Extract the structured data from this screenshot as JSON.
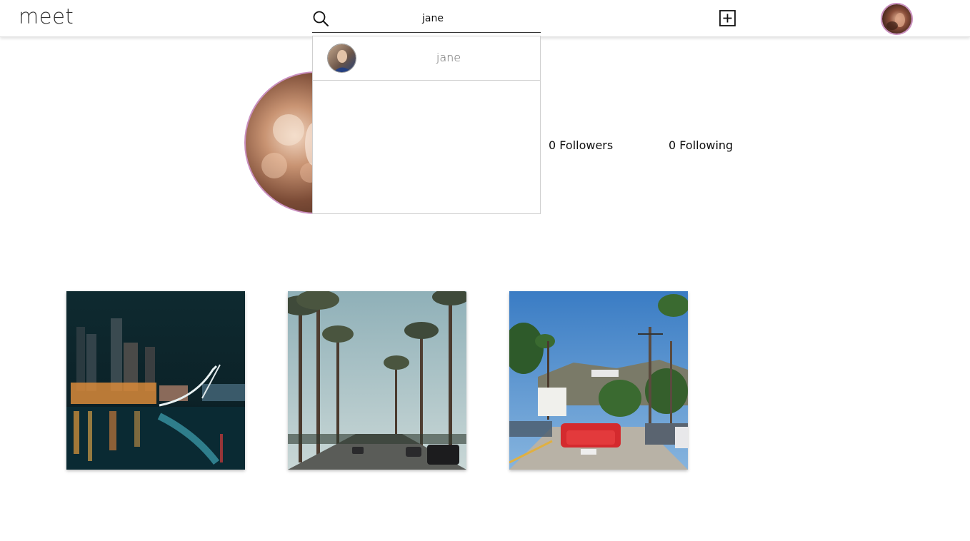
{
  "header": {
    "logo": "meet",
    "search": {
      "value": "jane",
      "placeholder": ""
    }
  },
  "search_results": [
    {
      "name": "jane"
    }
  ],
  "profile": {
    "followers_label": "0 Followers",
    "following_label": "0 Following"
  },
  "posts": [
    {
      "description": "city skyline at night with bridge"
    },
    {
      "description": "palm tree lined street"
    },
    {
      "description": "street with red convertible and Hollywood sign"
    }
  ],
  "colors": {
    "avatar_ring": "#c98fbf",
    "divider": "#cfcfcf"
  },
  "icons": {
    "search": "search-icon",
    "add": "plus-square-icon"
  }
}
